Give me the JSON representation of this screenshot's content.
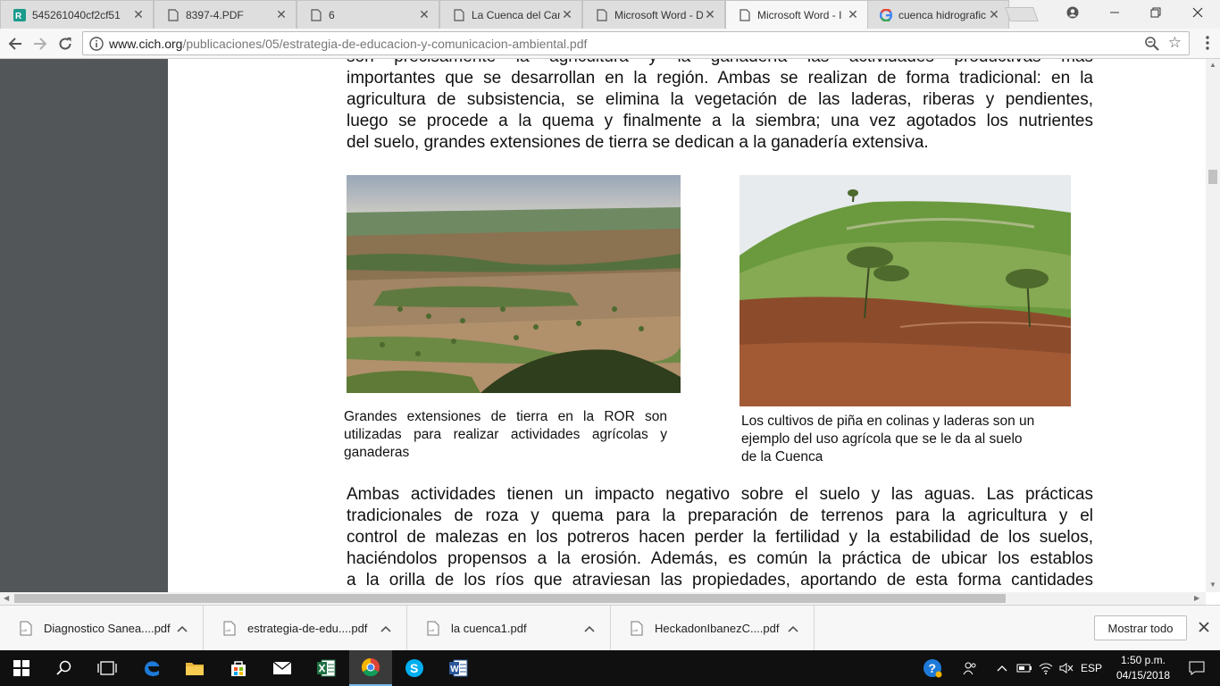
{
  "tabs": [
    {
      "title": "545261040cf2cf51",
      "icon": "r-app-icon"
    },
    {
      "title": "8397-4.PDF",
      "icon": "document-icon"
    },
    {
      "title": "6",
      "icon": "document-icon"
    },
    {
      "title": "La Cuenca del Can",
      "icon": "document-icon"
    },
    {
      "title": "Microsoft Word - D",
      "icon": "document-icon"
    },
    {
      "title": "Microsoft Word - I",
      "icon": "document-icon",
      "active": true
    },
    {
      "title": "cuenca hidrografic",
      "icon": "google-icon"
    }
  ],
  "address_bar": {
    "host": "www.cich.org",
    "path": "/publicaciones/05/estrategia-de-educacion-y-comunicacion-ambiental.pdf"
  },
  "document": {
    "paragraph1": [
      "son precisamente la agricultura y la ganadería las actividades productivas más",
      "importantes que se desarrollan en la región.  Ambas se realizan de forma tradicional: en la",
      "agricultura de subsistencia, se elimina la vegetación de las laderas, riberas y pendientes,",
      "luego se procede a la quema y finalmente a la siembra; una vez agotados los nutrientes",
      "del suelo, grandes extensiones de tierra se dedican a la ganadería extensiva."
    ],
    "caption1": [
      "Grandes extensiones de tierra en la ROR son",
      "utilizadas para realizar actividades agrícolas y",
      "ganaderas"
    ],
    "caption2": [
      "Los cultivos de piña en colinas y laderas son un",
      "ejemplo del uso agrícola que se le da al suelo",
      "de la Cuenca"
    ],
    "paragraph2": [
      "Ambas actividades tienen un impacto negativo sobre el suelo y las aguas.  Las prácticas",
      "tradicionales de roza y quema para la preparación de terrenos para la agricultura y el",
      "control de malezas en los potreros hacen perder la fertilidad y la estabilidad de los suelos,",
      "haciéndolos propensos a la erosión.  Además, es común la práctica de ubicar los establos",
      "a la orilla de los ríos que atraviesan las propiedades, aportando de esta forma cantidades"
    ]
  },
  "downloads": [
    {
      "name": "Diagnostico Sanea....pdf"
    },
    {
      "name": "estrategia-de-edu....pdf"
    },
    {
      "name": "la cuenca1.pdf"
    },
    {
      "name": "HeckadonIbanezC....pdf"
    }
  ],
  "downloads_show_all": "Mostrar todo",
  "taskbar": {
    "apps": [
      "windows-start",
      "search",
      "task-view",
      "edge",
      "file-explorer",
      "store",
      "mail",
      "excel",
      "chrome",
      "skype",
      "word"
    ],
    "language": "ESP",
    "time": "1:50 p.m.",
    "date": "04/15/2018"
  },
  "colors": {
    "viewer_sidebar": "#525659",
    "taskbar": "#101010",
    "accent": "#76b9ed"
  }
}
